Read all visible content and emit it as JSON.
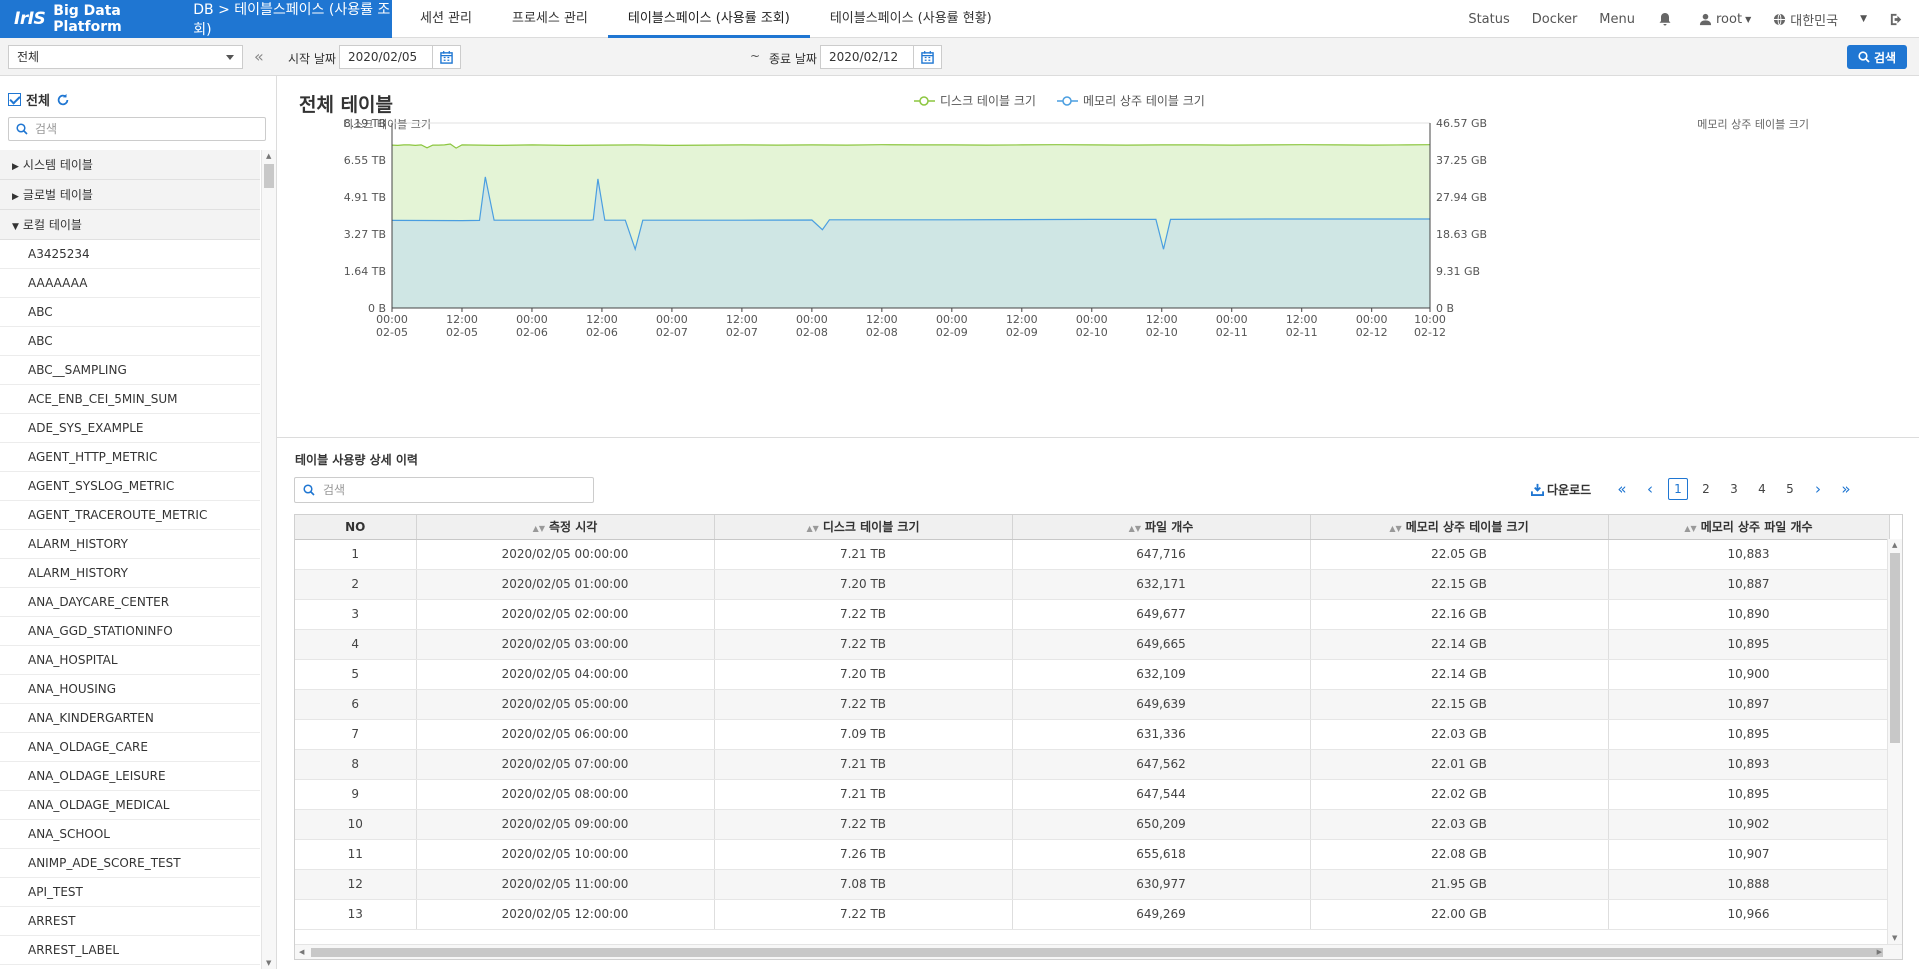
{
  "header": {
    "logo": "IrIS",
    "platform": "Big Data Platform",
    "breadcrumb": "DB > 테이블스페이스 (사용률 조회)",
    "tabs": [
      {
        "label": "세션 관리"
      },
      {
        "label": "프로세스 관리"
      },
      {
        "label": "테이블스페이스 (사용률 조회)"
      },
      {
        "label": "테이블스페이스 (사용률 현황)"
      }
    ],
    "status": "Status",
    "docker": "Docker",
    "menu": "Menu",
    "user": "root",
    "country": "대한민국"
  },
  "sidebar": {
    "select_value": "전체",
    "all_label": "전체",
    "search_placeholder": "검색",
    "groups": [
      "시스템 테이블",
      "글로벌 테이블",
      "로컬 테이블"
    ],
    "items": [
      "A3425234",
      "AAAAAAA",
      "ABC",
      "ABC",
      "ABC__SAMPLING",
      "ACE_ENB_CEI_5MIN_SUM",
      "ADE_SYS_EXAMPLE",
      "AGENT_HTTP_METRIC",
      "AGENT_SYSLOG_METRIC",
      "AGENT_TRACEROUTE_METRIC",
      "ALARM_HISTORY",
      "ALARM_HISTORY",
      "ANA_DAYCARE_CENTER",
      "ANA_GGD_STATIONINFO",
      "ANA_HOSPITAL",
      "ANA_HOUSING",
      "ANA_KINDERGARTEN",
      "ANA_OLDAGE_CARE",
      "ANA_OLDAGE_LEISURE",
      "ANA_OLDAGE_MEDICAL",
      "ANA_SCHOOL",
      "ANIMP_ADE_SCORE_TEST",
      "API_TEST",
      "ARREST",
      "ARREST_LABEL"
    ]
  },
  "filter": {
    "start_label": "시작 날짜",
    "start_date": "2020/02/05",
    "tilde": "~",
    "end_label": "종료 날짜",
    "end_date": "2020/02/12",
    "search_button": "검색"
  },
  "chart": {
    "title": "전체 테이블",
    "legend": [
      "디스크 테이블 크기",
      "메모리 상주 테이블 크기"
    ],
    "y_left_title": "디스크 테이블 크기",
    "y_right_title": "메모리 상주 테이블 크기"
  },
  "chart_data": {
    "type": "area",
    "x_ticks": [
      {
        "time": "00:00",
        "date": "02-05"
      },
      {
        "time": "12:00",
        "date": "02-05"
      },
      {
        "time": "00:00",
        "date": "02-06"
      },
      {
        "time": "12:00",
        "date": "02-06"
      },
      {
        "time": "00:00",
        "date": "02-07"
      },
      {
        "time": "12:00",
        "date": "02-07"
      },
      {
        "time": "00:00",
        "date": "02-08"
      },
      {
        "time": "12:00",
        "date": "02-08"
      },
      {
        "time": "00:00",
        "date": "02-09"
      },
      {
        "time": "12:00",
        "date": "02-09"
      },
      {
        "time": "00:00",
        "date": "02-10"
      },
      {
        "time": "12:00",
        "date": "02-10"
      },
      {
        "time": "00:00",
        "date": "02-11"
      },
      {
        "time": "12:00",
        "date": "02-11"
      },
      {
        "time": "00:00",
        "date": "02-12"
      },
      {
        "time": "10:00",
        "date": "02-12"
      }
    ],
    "y_left_ticks": [
      "8.19 TB",
      "6.55 TB",
      "4.91 TB",
      "3.27 TB",
      "1.64 TB",
      "0 B"
    ],
    "y_right_ticks": [
      "46.57 GB",
      "37.25 GB",
      "27.94 GB",
      "18.63 GB",
      "9.31 GB",
      "0 B"
    ],
    "ylim_left_tb": [
      0,
      8.19
    ],
    "ylim_right_gb": [
      0,
      46.57
    ],
    "x_range_hours": [
      0,
      178
    ],
    "series": [
      {
        "name": "디스크 테이블 크기",
        "unit": "TB",
        "color": "#8cc63f",
        "fill": "#e4f4d6",
        "points": [
          [
            0,
            7.21
          ],
          [
            1,
            7.2
          ],
          [
            2,
            7.22
          ],
          [
            3,
            7.22
          ],
          [
            4,
            7.2
          ],
          [
            5,
            7.22
          ],
          [
            6,
            7.09
          ],
          [
            7,
            7.21
          ],
          [
            8,
            7.21
          ],
          [
            9,
            7.22
          ],
          [
            10,
            7.26
          ],
          [
            11,
            7.08
          ],
          [
            12,
            7.22
          ],
          [
            18,
            7.2
          ],
          [
            24,
            7.22
          ],
          [
            30,
            7.2
          ],
          [
            36,
            7.21
          ],
          [
            42,
            7.22
          ],
          [
            48,
            7.2
          ],
          [
            54,
            7.21
          ],
          [
            60,
            7.22
          ],
          [
            66,
            7.21
          ],
          [
            72,
            7.22
          ],
          [
            78,
            7.21
          ],
          [
            84,
            7.23
          ],
          [
            90,
            7.22
          ],
          [
            96,
            7.22
          ],
          [
            102,
            7.21
          ],
          [
            108,
            7.22
          ],
          [
            114,
            7.23
          ],
          [
            120,
            7.22
          ],
          [
            126,
            7.21
          ],
          [
            132,
            7.22
          ],
          [
            138,
            7.22
          ],
          [
            144,
            7.21
          ],
          [
            150,
            7.22
          ],
          [
            156,
            7.23
          ],
          [
            162,
            7.22
          ],
          [
            168,
            7.21
          ],
          [
            174,
            7.22
          ],
          [
            178,
            7.23
          ]
        ]
      },
      {
        "name": "메모리 상주 테이블 크기",
        "unit": "GB",
        "color": "#4a9ee0",
        "fill": "#cfe6e4",
        "points": [
          [
            0,
            22.05
          ],
          [
            12,
            22.0
          ],
          [
            15,
            22.05
          ],
          [
            16,
            33.0
          ],
          [
            17.5,
            22.1
          ],
          [
            34,
            22.1
          ],
          [
            34.5,
            22.2
          ],
          [
            35.3,
            32.5
          ],
          [
            36.5,
            22.1
          ],
          [
            40,
            22.1
          ],
          [
            41.7,
            14.8
          ],
          [
            43,
            22.1
          ],
          [
            60,
            22.1
          ],
          [
            72,
            22.15
          ],
          [
            73.8,
            19.7
          ],
          [
            75,
            22.2
          ],
          [
            96,
            22.2
          ],
          [
            120,
            22.3
          ],
          [
            131,
            22.3
          ],
          [
            132.3,
            14.8
          ],
          [
            133.5,
            22.3
          ],
          [
            150,
            22.4
          ],
          [
            178,
            22.4
          ]
        ]
      }
    ]
  },
  "detail": {
    "title": "테이블 사용량 상세 이력",
    "search_placeholder": "검색",
    "download": "다운로드",
    "pages": [
      "1",
      "2",
      "3",
      "4",
      "5"
    ],
    "columns": [
      "NO",
      "측정 시각",
      "디스크 테이블 크기",
      "파일 개수",
      "메모리 상주 테이블 크기",
      "메모리 상주 파일 개수"
    ],
    "rows": [
      [
        "1",
        "2020/02/05 00:00:00",
        "7.21 TB",
        "647,716",
        "22.05 GB",
        "10,883"
      ],
      [
        "2",
        "2020/02/05 01:00:00",
        "7.20 TB",
        "632,171",
        "22.15 GB",
        "10,887"
      ],
      [
        "3",
        "2020/02/05 02:00:00",
        "7.22 TB",
        "649,677",
        "22.16 GB",
        "10,890"
      ],
      [
        "4",
        "2020/02/05 03:00:00",
        "7.22 TB",
        "649,665",
        "22.14 GB",
        "10,895"
      ],
      [
        "5",
        "2020/02/05 04:00:00",
        "7.20 TB",
        "632,109",
        "22.14 GB",
        "10,900"
      ],
      [
        "6",
        "2020/02/05 05:00:00",
        "7.22 TB",
        "649,639",
        "22.15 GB",
        "10,897"
      ],
      [
        "7",
        "2020/02/05 06:00:00",
        "7.09 TB",
        "631,336",
        "22.03 GB",
        "10,895"
      ],
      [
        "8",
        "2020/02/05 07:00:00",
        "7.21 TB",
        "647,562",
        "22.01 GB",
        "10,893"
      ],
      [
        "9",
        "2020/02/05 08:00:00",
        "7.21 TB",
        "647,544",
        "22.02 GB",
        "10,895"
      ],
      [
        "10",
        "2020/02/05 09:00:00",
        "7.22 TB",
        "650,209",
        "22.03 GB",
        "10,902"
      ],
      [
        "11",
        "2020/02/05 10:00:00",
        "7.26 TB",
        "655,618",
        "22.08 GB",
        "10,907"
      ],
      [
        "12",
        "2020/02/05 11:00:00",
        "7.08 TB",
        "630,977",
        "21.95 GB",
        "10,888"
      ],
      [
        "13",
        "2020/02/05 12:00:00",
        "7.22 TB",
        "649,269",
        "22.00 GB",
        "10,966"
      ]
    ]
  },
  "colors": {
    "accent": "#1f76d2",
    "disk": "#8cc63f",
    "memory": "#4a9ee0"
  }
}
